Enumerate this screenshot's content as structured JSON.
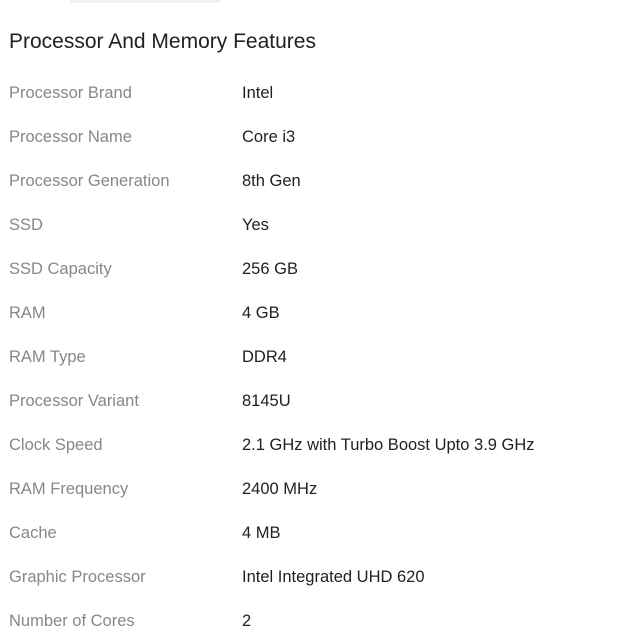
{
  "section": {
    "title": "Processor And Memory Features",
    "rows": [
      {
        "key": "Processor Brand",
        "value": "Intel"
      },
      {
        "key": "Processor Name",
        "value": "Core i3"
      },
      {
        "key": "Processor Generation",
        "value": "8th Gen"
      },
      {
        "key": "SSD",
        "value": "Yes"
      },
      {
        "key": "SSD Capacity",
        "value": "256 GB"
      },
      {
        "key": "RAM",
        "value": "4 GB"
      },
      {
        "key": "RAM Type",
        "value": "DDR4"
      },
      {
        "key": "Processor Variant",
        "value": "8145U"
      },
      {
        "key": "Clock Speed",
        "value": "2.1 GHz with Turbo Boost Upto 3.9 GHz"
      },
      {
        "key": "RAM Frequency",
        "value": "2400 MHz"
      },
      {
        "key": "Cache",
        "value": "4 MB"
      },
      {
        "key": "Graphic Processor",
        "value": "Intel Integrated UHD 620"
      },
      {
        "key": "Number of Cores",
        "value": "2"
      }
    ]
  }
}
